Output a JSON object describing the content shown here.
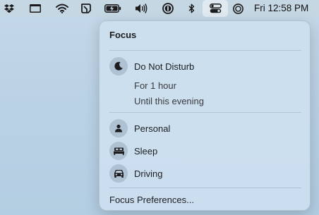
{
  "menubar": {
    "icons": [
      "dropbox-icon",
      "app-window-icon",
      "wifi-icon",
      "scroll-icon",
      "battery-charging-icon",
      "volume-icon",
      "one-password-icon",
      "bluetooth-icon",
      "control-center-icon",
      "siri-icon"
    ],
    "clock": "Fri 12:58 PM"
  },
  "focus_panel": {
    "title": "Focus",
    "do_not_disturb": {
      "label": "Do Not Disturb",
      "icon": "moon-icon",
      "options": [
        "For 1 hour",
        "Until this evening"
      ]
    },
    "modes": [
      {
        "label": "Personal",
        "icon": "person-icon"
      },
      {
        "label": "Sleep",
        "icon": "bed-icon"
      },
      {
        "label": "Driving",
        "icon": "car-icon"
      }
    ],
    "preferences_label": "Focus Preferences..."
  }
}
